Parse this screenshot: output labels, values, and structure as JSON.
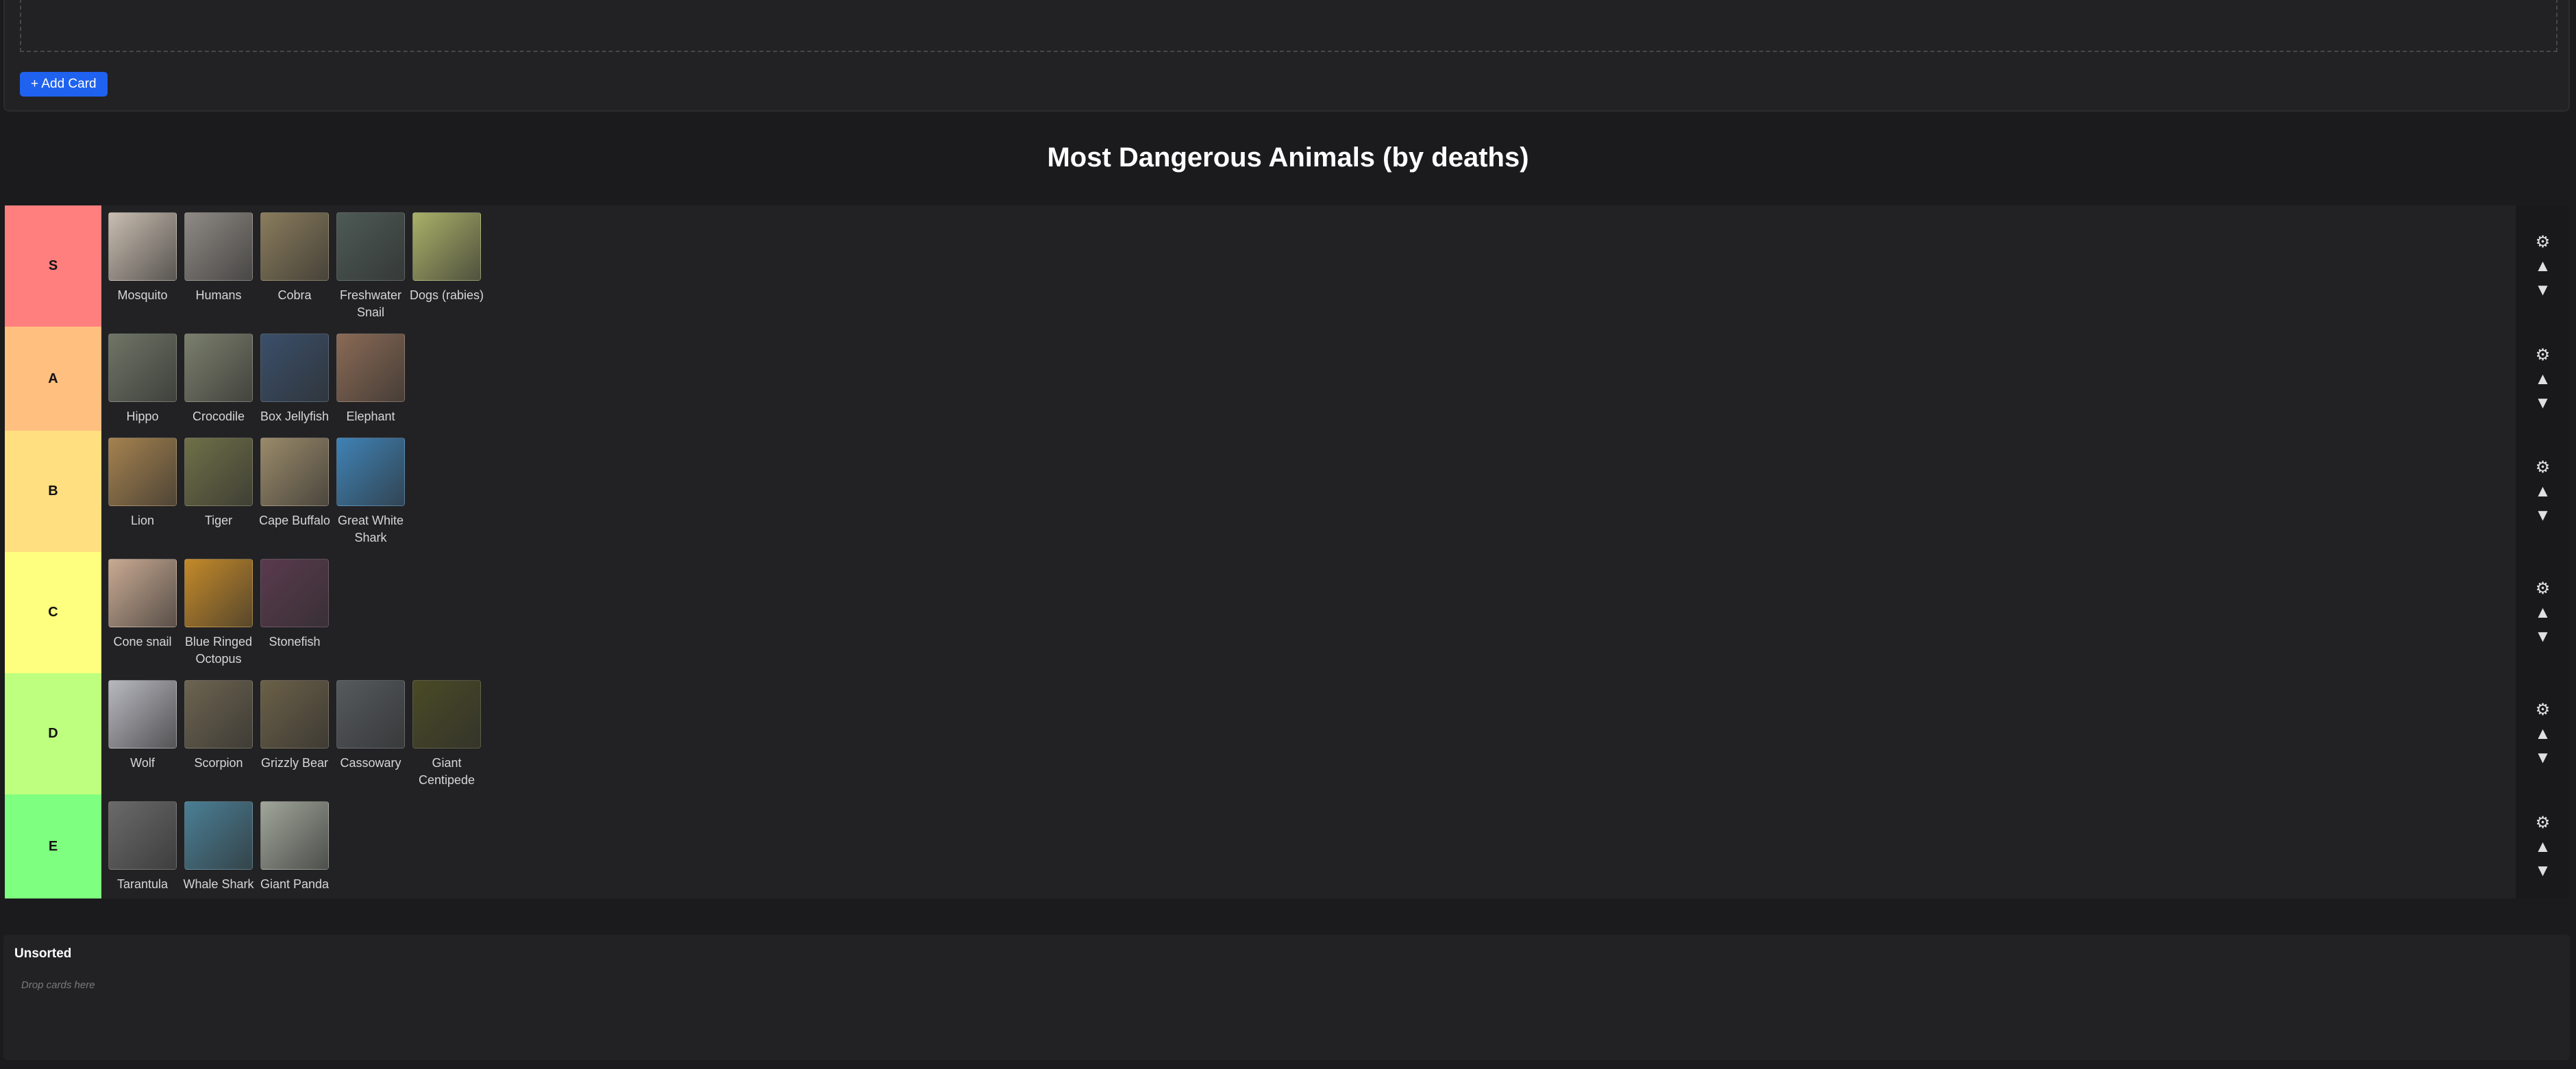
{
  "top": {
    "add_card_label": "+ Add Card"
  },
  "page_title": "Most Dangerous Animals (by deaths)",
  "controls": {
    "settings_glyph": "⚙",
    "up_glyph": "▲",
    "down_glyph": "▼"
  },
  "tiers": [
    {
      "label": "S",
      "color": "#ff7f7f",
      "items": [
        {
          "name": "Mosquito",
          "thumb": "#c9bdb0"
        },
        {
          "name": "Humans",
          "thumb": "#8f8a84"
        },
        {
          "name": "Cobra",
          "thumb": "#8a7c5c"
        },
        {
          "name": "Freshwater Snail",
          "thumb": "#4d5a55"
        },
        {
          "name": "Dogs (rabies)",
          "thumb": "#a9b068"
        }
      ]
    },
    {
      "label": "A",
      "color": "#ffbf7f",
      "items": [
        {
          "name": "Hippo",
          "thumb": "#6f7566"
        },
        {
          "name": "Crocodile",
          "thumb": "#7b7f6c"
        },
        {
          "name": "Box Jellyfish",
          "thumb": "#3a4f6a"
        },
        {
          "name": "Elephant",
          "thumb": "#8a6a55"
        }
      ]
    },
    {
      "label": "B",
      "color": "#ffdf7f",
      "items": [
        {
          "name": "Lion",
          "thumb": "#a5824f"
        },
        {
          "name": "Tiger",
          "thumb": "#6f7048"
        },
        {
          "name": "Cape Buffalo",
          "thumb": "#9a8a6a"
        },
        {
          "name": "Great White Shark",
          "thumb": "#3f82b5"
        }
      ]
    },
    {
      "label": "C",
      "color": "#ffff7f",
      "items": [
        {
          "name": "Cone snail",
          "thumb": "#c9aa92"
        },
        {
          "name": "Blue Ringed Octopus",
          "thumb": "#c48a2a"
        },
        {
          "name": "Stonefish",
          "thumb": "#5a3a4e"
        }
      ]
    },
    {
      "label": "D",
      "color": "#bfff7f",
      "items": [
        {
          "name": "Wolf",
          "thumb": "#b8b8c0"
        },
        {
          "name": "Scorpion",
          "thumb": "#6d6450"
        },
        {
          "name": "Grizzly Bear",
          "thumb": "#6b6048"
        },
        {
          "name": "Cassowary",
          "thumb": "#555a5e"
        },
        {
          "name": "Giant Centipede",
          "thumb": "#4a4a26"
        }
      ]
    },
    {
      "label": "E",
      "color": "#7fff7f",
      "items": [
        {
          "name": "Tarantula",
          "thumb": "#6a6a6a"
        },
        {
          "name": "Whale Shark",
          "thumb": "#4a7f95"
        },
        {
          "name": "Giant Panda",
          "thumb": "#a0a69a"
        }
      ]
    }
  ],
  "unsorted": {
    "title": "Unsorted",
    "hint": "Drop cards here"
  }
}
